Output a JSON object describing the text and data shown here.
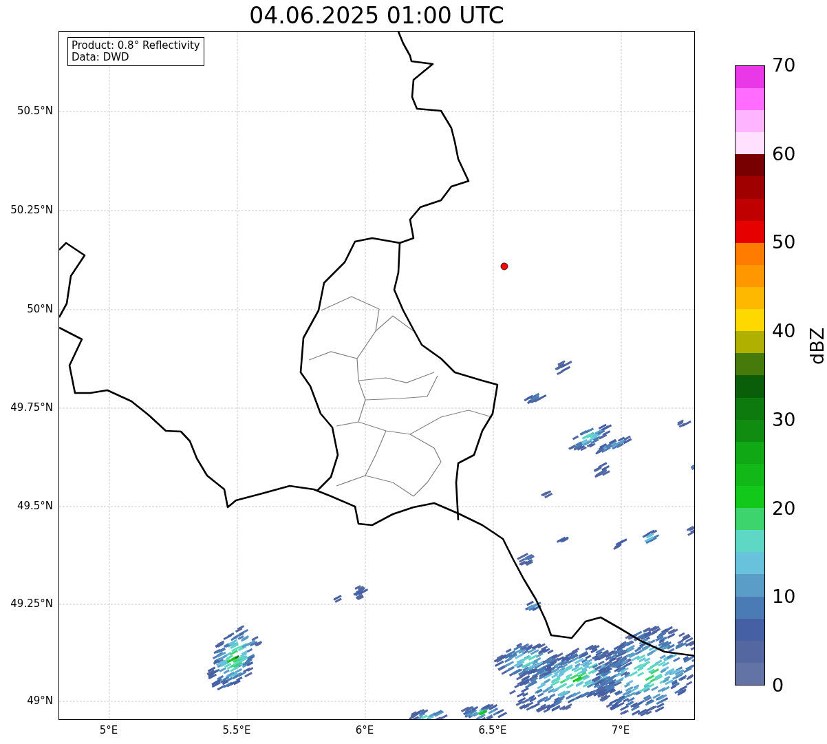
{
  "title": "04.06.2025 01:00 UTC",
  "info_box": [
    "Product: 0.8° Reflectivity",
    "Data: DWD"
  ],
  "lat_labels": [
    "50.5°N",
    "50.25°N",
    "50°N",
    "49.75°N",
    "49.5°N",
    "49.25°N",
    "49°N"
  ],
  "lon_labels": [
    "5°E",
    "5.5°E",
    "6°E",
    "6.5°E",
    "7°E"
  ],
  "colorbar": {
    "label": "dBZ",
    "ticks": [
      "70",
      "60",
      "50",
      "40",
      "30",
      "20",
      "10",
      "0"
    ],
    "segments": [
      {
        "color": "#6473a6"
      },
      {
        "color": "#5567a0"
      },
      {
        "color": "#4560a4"
      },
      {
        "color": "#4a7bb4"
      },
      {
        "color": "#5a9ec8"
      },
      {
        "color": "#68c2dc"
      },
      {
        "color": "#5ed8c4"
      },
      {
        "color": "#3dd46e"
      },
      {
        "color": "#12c81a"
      },
      {
        "color": "#12b818"
      },
      {
        "color": "#10a814"
      },
      {
        "color": "#108c10"
      },
      {
        "color": "#0c7a0c"
      },
      {
        "color": "#0a5e0a"
      },
      {
        "color": "#467a0a"
      },
      {
        "color": "#b0b000"
      },
      {
        "color": "#ffd800"
      },
      {
        "color": "#ffb800"
      },
      {
        "color": "#ff9800"
      },
      {
        "color": "#ff7c00"
      },
      {
        "color": "#e60000"
      },
      {
        "color": "#c00000"
      },
      {
        "color": "#a00000"
      },
      {
        "color": "#780000"
      },
      {
        "color": "#ffe0ff"
      },
      {
        "color": "#ffb4ff"
      },
      {
        "color": "#ff6cff"
      },
      {
        "color": "#e838e8"
      }
    ]
  }
}
